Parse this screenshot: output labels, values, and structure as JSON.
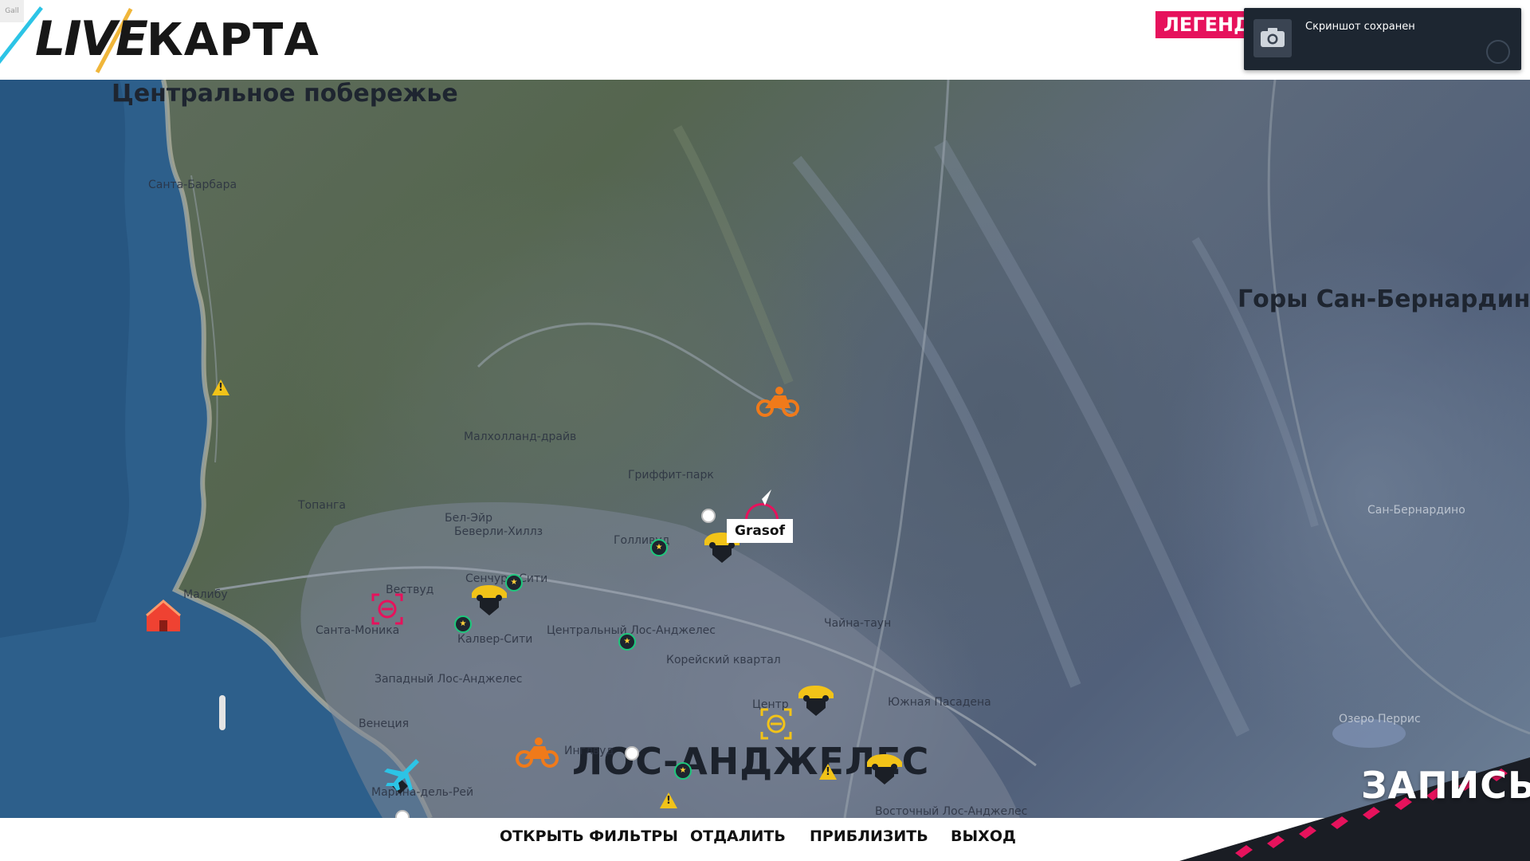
{
  "header": {
    "logo_live": "LIVE",
    "logo_map": "КАРТА",
    "corner_label": "Gall",
    "legend_label": "ЛЕГЕНДА"
  },
  "toast": {
    "message": "Скриншот сохранен",
    "icon": "camera-icon"
  },
  "map": {
    "regions": {
      "central_coast": "Центральное побережье",
      "san_bernardino_mountains": "Горы Сан-Бернардино"
    },
    "city": "ЛОС-АНДЖЕЛЕС",
    "districts": {
      "santa_barbara": "Санта-Барбара",
      "mulholland": "Малхолланд-драйв",
      "griffith": "Гриффит-парк",
      "topanga": "Топанга",
      "bel_air": "Бел-Эйр",
      "beverly_hills": "Беверли-Хиллз",
      "hollywood": "Голливуд",
      "century_city": "Сенчури-Сити",
      "westwood": "Вествуд",
      "malibu": "Малибу",
      "santa_monica": "Санта-Моника",
      "culver_city": "Калвер-Сити",
      "central_la": "Центральный Лос-Анджелес",
      "chinatown": "Чайна-таун",
      "koreatown": "Корейский квартал",
      "west_la": "Западный Лос-Анджелес",
      "downtown": "Центр",
      "south_pasadena": "Южная Пасадена",
      "venice": "Венеция",
      "inglewood": "Инглвуд",
      "marina_del_rey": "Марина-дель-Рей",
      "east_la": "Восточный Лос-Анджелес",
      "san_bernardino": "Сан-Бернардино",
      "lake_perris": "Озеро Перрис"
    },
    "player_name": "Grasof"
  },
  "footer": {
    "open_filters": "ОТКРЫТЬ ФИЛЬТРЫ",
    "zoom_out": "ОТДАЛИТЬ",
    "zoom_in": "ПРИБЛИЗИТЬ",
    "exit": "ВЫХОД",
    "recording": "ЗАПИСЬ"
  },
  "colors": {
    "accent": "#e6125c",
    "marker_yellow": "#f2c318",
    "marker_orange": "#f07a1a",
    "marker_blue": "#2cc4e6",
    "header_bg": "#ffffff",
    "toast_bg": "#1d2631"
  }
}
